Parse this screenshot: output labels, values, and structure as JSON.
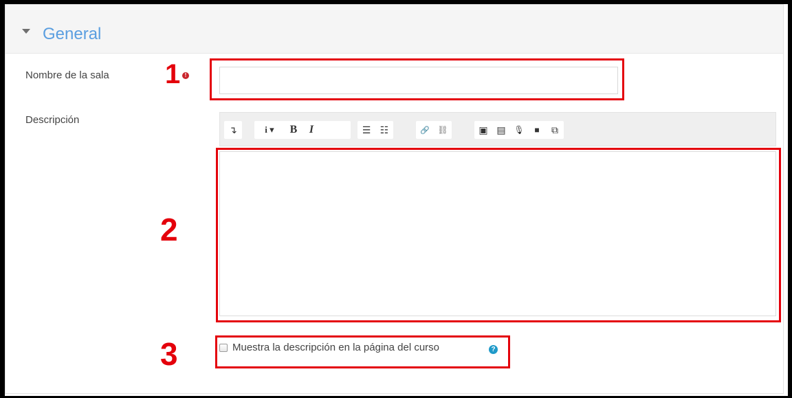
{
  "section": {
    "title": "General",
    "toggle_icon": "caret-down-icon"
  },
  "fields": {
    "name": {
      "label": "Nombre de la sala",
      "value": "",
      "placeholder": "",
      "required": true
    },
    "description": {
      "label": "Descripción",
      "value": ""
    },
    "show_description": {
      "label": "Muestra la descripción en la página del curso",
      "checked": false
    }
  },
  "annotations": {
    "n1": "1",
    "n2": "2",
    "n3": "3",
    "color": "#e4000b"
  },
  "icons": {
    "required": "!",
    "help": "?"
  },
  "toolbar": [
    {
      "name": "toolbar-toggle-icon",
      "glyph": "↴"
    },
    {
      "name": "paragraph-styles-icon",
      "glyph": "i ▾"
    },
    {
      "name": "bold-icon",
      "glyph": "B"
    },
    {
      "name": "italic-icon",
      "glyph": "I"
    },
    {
      "name": "unordered-list-icon",
      "glyph": "☰"
    },
    {
      "name": "ordered-list-icon",
      "glyph": "☷"
    },
    {
      "name": "link-icon",
      "glyph": "🔗"
    },
    {
      "name": "unlink-icon",
      "glyph": "⛓"
    },
    {
      "name": "image-icon",
      "glyph": "▣"
    },
    {
      "name": "media-icon",
      "glyph": "▤"
    },
    {
      "name": "record-audio-icon",
      "glyph": "🎙"
    },
    {
      "name": "record-video-icon",
      "glyph": "■"
    },
    {
      "name": "manage-files-icon",
      "glyph": "⧉"
    }
  ],
  "colors": {
    "accent": "#5a9ee0",
    "help": "#1f9ac9",
    "required": "#c9252c"
  }
}
